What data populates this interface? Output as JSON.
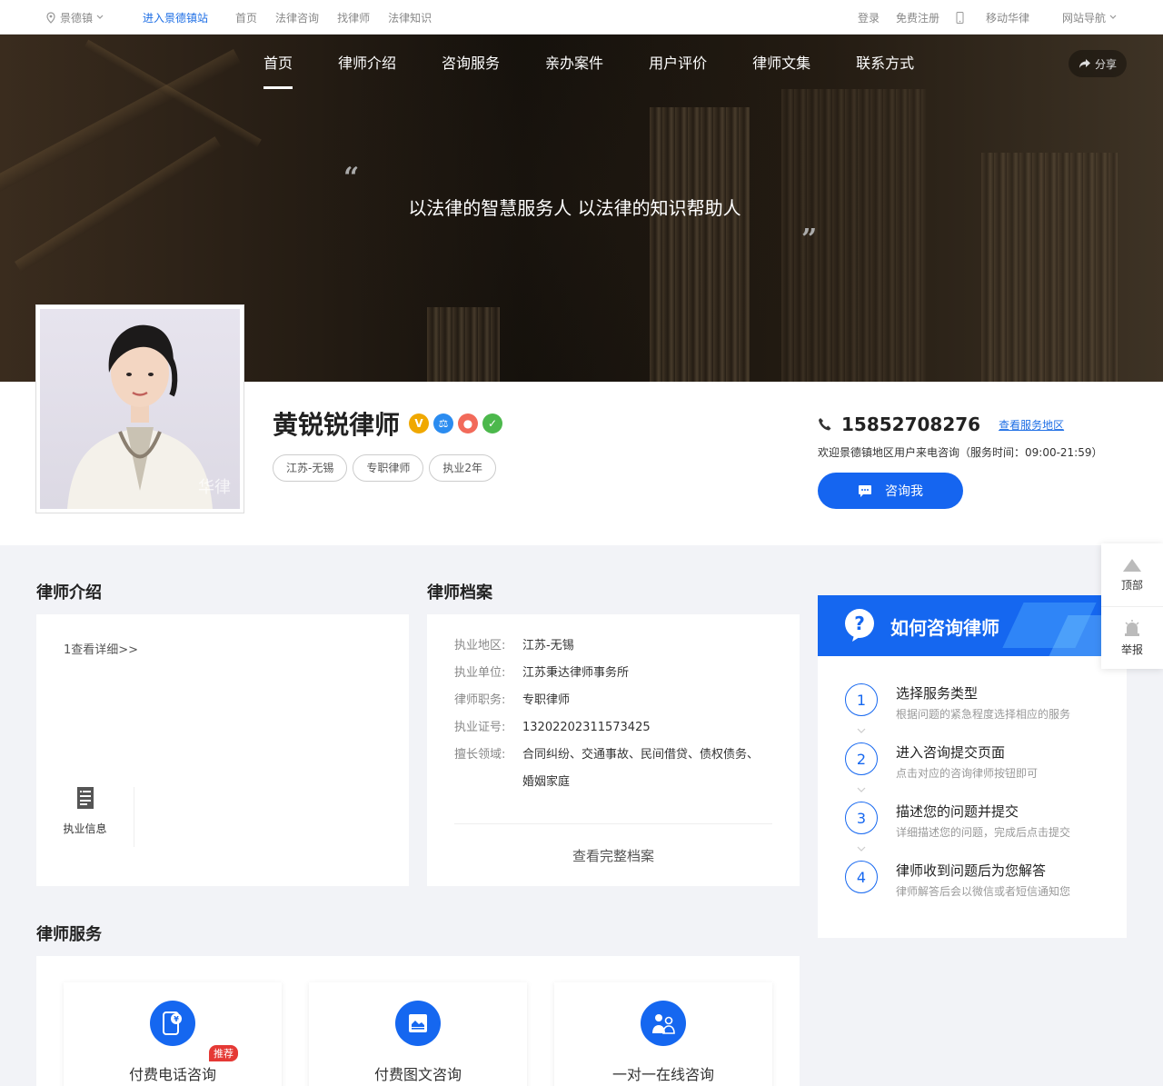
{
  "topbar": {
    "location": "景德镇",
    "station_link": "进入景德镇站",
    "links": [
      "首页",
      "法律咨询",
      "找律师",
      "法律知识"
    ],
    "login": "登录",
    "register": "免费注册",
    "mobile": "移动华律",
    "site_nav": "网站导航"
  },
  "nav": {
    "tabs": [
      "首页",
      "律师介绍",
      "咨询服务",
      "亲办案件",
      "用户评价",
      "律师文集",
      "联系方式"
    ],
    "share": "分享"
  },
  "hero": {
    "slogan": "以法律的智慧服务人 以法律的知识帮助人"
  },
  "profile": {
    "name": "黄锐锐律师",
    "tags": [
      "江苏-无锡",
      "专职律师",
      "执业2年"
    ],
    "phone": "15852708276",
    "service_area_link": "查看服务地区",
    "phone_note": "欢迎景德镇地区用户来电咨询（服务时间：09:00-21:59）",
    "consult_button": "咨询我",
    "photo_watermark": "华律"
  },
  "intro": {
    "title": "律师介绍",
    "text": "1查看详细>>",
    "exec_info_label": "执业信息"
  },
  "archive": {
    "title": "律师档案",
    "rows": [
      {
        "k": "执业地区:",
        "v": "江苏-无锡"
      },
      {
        "k": "执业单位:",
        "v": "江苏秉达律师事务所"
      },
      {
        "k": "律师职务:",
        "v": "专职律师"
      },
      {
        "k": "执业证号:",
        "v": "13202202311573425"
      },
      {
        "k": "擅长领域:",
        "v": "合同纠纷、交通事故、民间借贷、债权债务、婚姻家庭"
      }
    ],
    "more": "查看完整档案"
  },
  "how": {
    "title": "如何咨询律师",
    "steps": [
      {
        "n": "1",
        "h": "选择服务类型",
        "s": "根据问题的紧急程度选择相应的服务"
      },
      {
        "n": "2",
        "h": "进入咨询提交页面",
        "s": "点击对应的咨询律师按钮即可"
      },
      {
        "n": "3",
        "h": "描述您的问题并提交",
        "s": "详细描述您的问题，完成后点击提交"
      },
      {
        "n": "4",
        "h": "律师收到问题后为您解答",
        "s": "律师解答后会以微信或者短信通知您"
      }
    ]
  },
  "services": {
    "title": "律师服务",
    "items": [
      {
        "label": "付费电话咨询",
        "badge": "推荐"
      },
      {
        "label": "付费图文咨询"
      },
      {
        "label": "一对一在线咨询"
      }
    ]
  },
  "float": {
    "top": "顶部",
    "report": "举报"
  },
  "colors": {
    "accent": "#1567f0",
    "link": "#1f6fe5"
  }
}
